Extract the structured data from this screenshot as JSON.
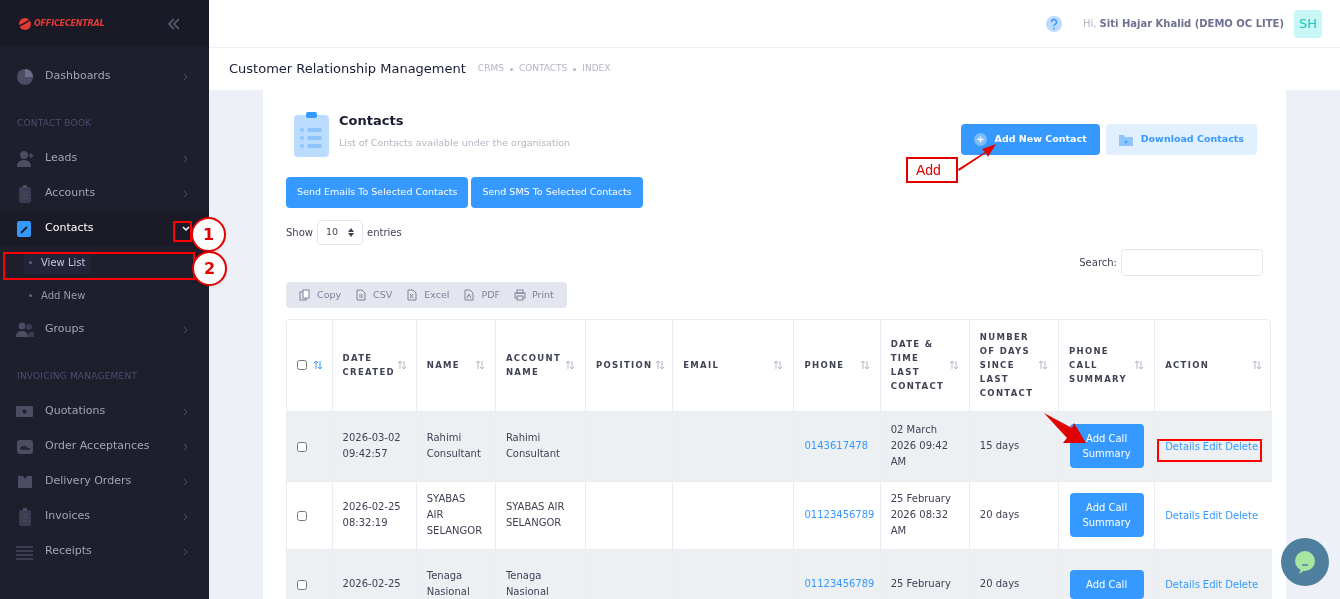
{
  "sidebar": {
    "logo": "OFFICECENTRAL",
    "sections": [
      {
        "items": [
          {
            "label": "Dashboards",
            "selected": false,
            "expanded": false
          }
        ]
      },
      {
        "heading": "CONTACT BOOK",
        "items": [
          {
            "label": "Leads",
            "selected": false,
            "expanded": false
          },
          {
            "label": "Accounts",
            "selected": false,
            "expanded": false
          },
          {
            "label": "Contacts",
            "selected": true,
            "expanded": true,
            "children": [
              {
                "label": "View List",
                "selected": true
              },
              {
                "label": "Add New",
                "selected": false
              }
            ]
          },
          {
            "label": "Groups",
            "selected": false,
            "expanded": false
          }
        ]
      },
      {
        "heading": "INVOICING MANAGEMENT",
        "items": [
          {
            "label": "Quotations",
            "selected": false,
            "expanded": false
          },
          {
            "label": "Order Acceptances",
            "selected": false,
            "expanded": false
          },
          {
            "label": "Delivery Orders",
            "selected": false,
            "expanded": false
          },
          {
            "label": "Invoices",
            "selected": false,
            "expanded": false
          },
          {
            "label": "Receipts",
            "selected": false,
            "expanded": false
          }
        ]
      }
    ]
  },
  "header": {
    "greeting": "Hi,",
    "user": "Siti Hajar Khalid (DEMO OC LITE)",
    "avatar": "SH"
  },
  "subheader": {
    "title": "Customer Relationship Management",
    "breadcrumbs": [
      "CRMS",
      "CONTACTS",
      "INDEX"
    ]
  },
  "card": {
    "title": "Contacts",
    "subtitle": "List of Contacts available under the organisation",
    "primary_button": "Add New Contact",
    "secondary_button": "Download Contacts",
    "bulk_buttons": [
      "Send Emails To Selected Contacts",
      "Send SMS To Selected Contacts"
    ],
    "show_label": "Show",
    "page_size": "10",
    "entries_label": "entries",
    "search_label": "Search:",
    "export_buttons": [
      "Copy",
      "CSV",
      "Excel",
      "PDF",
      "Print"
    ]
  },
  "table": {
    "select_all_checked": false,
    "columns": [
      "DATE CREATED",
      "NAME",
      "ACCOUNT NAME",
      "POSITION",
      "EMAIL",
      "PHONE",
      "DATE & TIME LAST CONTACT",
      "NUMBER OF DAYS SINCE LAST CONTACT",
      "PHONE CALL SUMMARY",
      "ACTION"
    ],
    "rows": [
      {
        "checked": false,
        "date_created": "2026-03-02 09:42:57",
        "name": "Rahimi Consultant",
        "account_name": "Rahimi Consultant",
        "phone": "0143617478",
        "last_contact": "02 March 2026 09:42 AM",
        "days": "15 days",
        "summary_button": "Add Call Summary",
        "actions": [
          "Details",
          "Edit",
          "Delete"
        ]
      },
      {
        "checked": false,
        "date_created": "2026-02-25 08:32:19",
        "name": "SYABAS AIR SELANGOR",
        "account_name": "SYABAS AIR SELANGOR",
        "phone": "01123456789",
        "last_contact": "25 February 2026 08:32 AM",
        "days": "20 days",
        "summary_button": "Add Call Summary",
        "actions": [
          "Details",
          "Edit",
          "Delete"
        ]
      },
      {
        "checked": false,
        "date_created": "2026-02-25",
        "name": "Tenaga Nasional",
        "account_name": "Tenaga Nasional",
        "phone": "01123456789",
        "last_contact": "25 February",
        "days": "20 days",
        "summary_button": "Add Call",
        "actions": [
          "Details",
          "Edit",
          "Delete"
        ]
      }
    ]
  },
  "annotations": {
    "markers": [
      "1",
      "2"
    ],
    "callout": "Add"
  }
}
